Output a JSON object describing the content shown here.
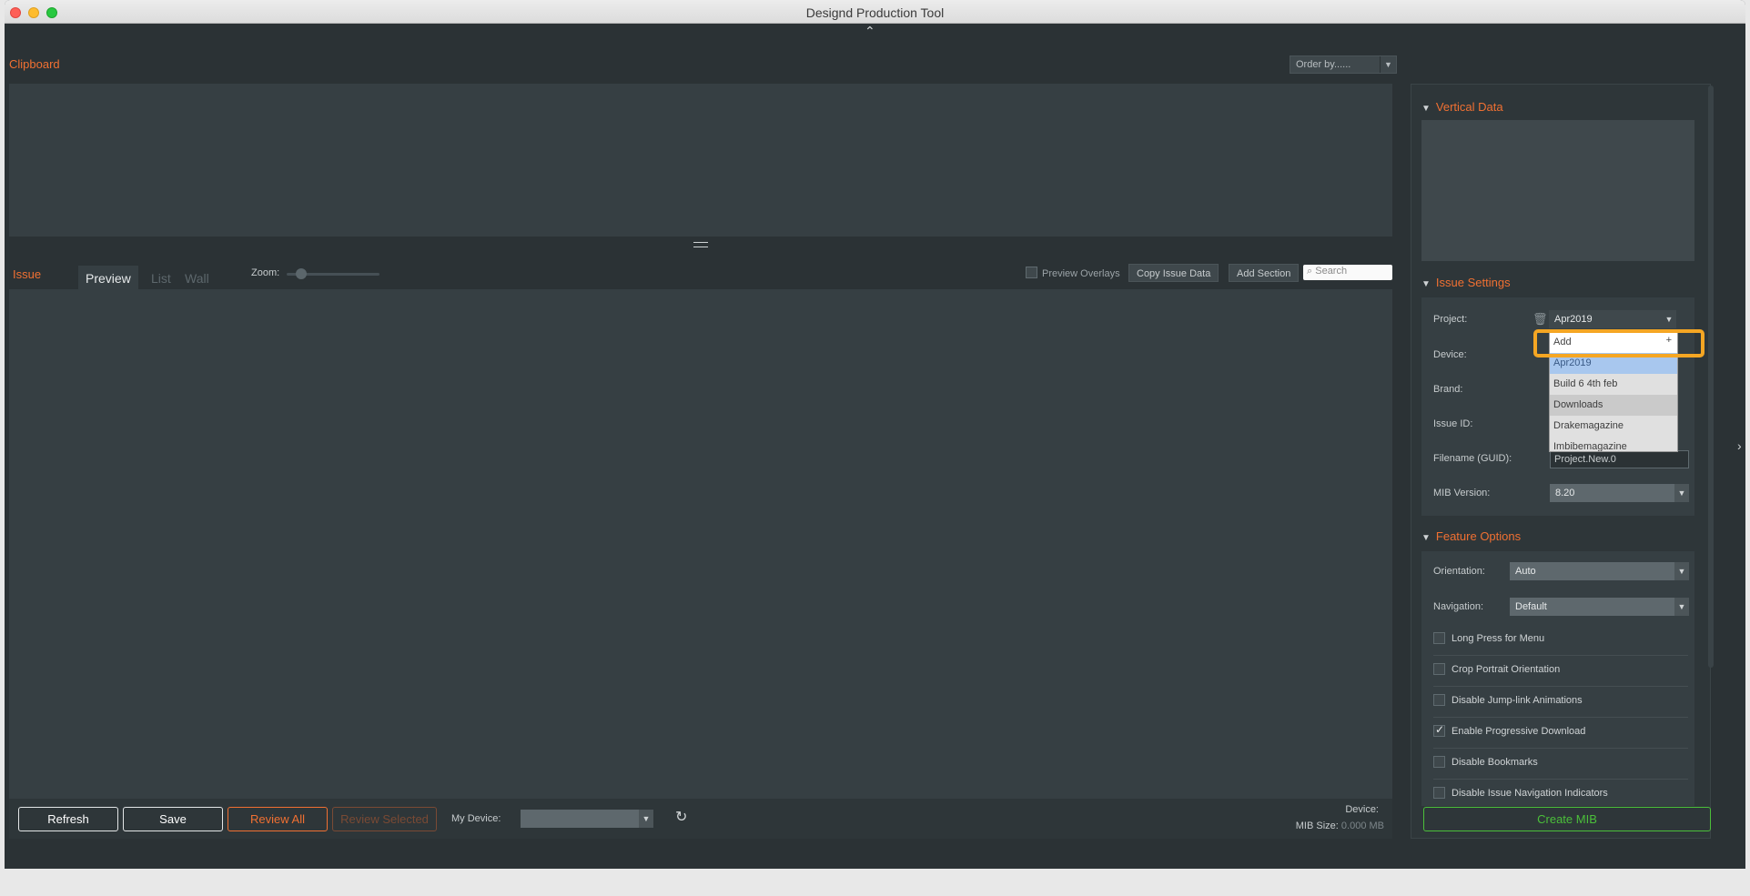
{
  "window": {
    "title": "Designd Production Tool"
  },
  "clipboard": {
    "label": "Clipboard",
    "order_by": "Order by......"
  },
  "issue": {
    "label": "Issue",
    "tabs": [
      {
        "label": "Preview",
        "active": true
      },
      {
        "label": "List",
        "active": false
      },
      {
        "label": "Wall",
        "active": false
      }
    ],
    "zoom_label": "Zoom:",
    "preview_overlays": "Preview Overlays",
    "copy_issue_data": "Copy Issue Data",
    "add_section": "Add Section",
    "search_placeholder": "Search"
  },
  "bottom": {
    "refresh": "Refresh",
    "save": "Save",
    "review_all": "Review All",
    "review_selected": "Review Selected",
    "my_device": "My Device:",
    "device_label": "Device:",
    "mib_size_label": "MIB Size:",
    "mib_size_value": "0.000 MB"
  },
  "vertical_data": {
    "label": "Vertical Data"
  },
  "issue_settings": {
    "label": "Issue Settings",
    "project_label": "Project:",
    "project_value": "Apr2019",
    "device_label": "Device:",
    "brand_label": "Brand:",
    "issue_id_label": "Issue ID:",
    "filename_label": "Filename (GUID):",
    "filename_value": "Project.New.0",
    "mib_version_label": "MIB Version:",
    "mib_version_value": "8.20"
  },
  "dropdown": {
    "add_label": "Add",
    "add_plus": "+",
    "items": [
      "Apr2019",
      "Build 6 4th feb",
      "Downloads",
      "Drakemagazine",
      "Imbibemagazine"
    ]
  },
  "feature_options": {
    "label": "Feature Options",
    "orientation_label": "Orientation:",
    "orientation_value": "Auto",
    "navigation_label": "Navigation:",
    "navigation_value": "Default",
    "options": [
      {
        "label": "Long Press for Menu",
        "checked": false
      },
      {
        "label": "Crop Portrait Orientation",
        "checked": false
      },
      {
        "label": "Disable Jump-link Animations",
        "checked": false
      },
      {
        "label": "Enable Progressive Download",
        "checked": true
      },
      {
        "label": "Disable Bookmarks",
        "checked": false
      },
      {
        "label": "Disable Issue Navigation Indicators",
        "checked": false
      }
    ]
  },
  "create_mib": "Create MIB"
}
